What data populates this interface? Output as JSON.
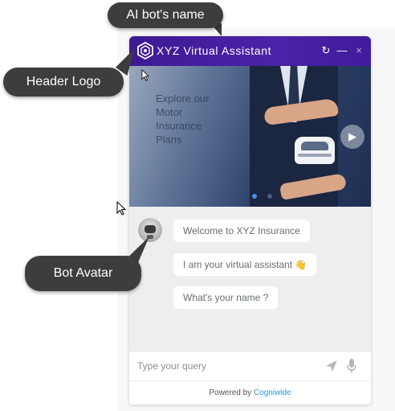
{
  "header": {
    "title": "XYZ Virtual Assistant",
    "logo_icon": "hexagon-logo-icon",
    "refresh_icon": "↻",
    "minimize_icon": "—",
    "close_icon": "×",
    "color": "#4a23a8"
  },
  "banner": {
    "text_lines": [
      "Explore our",
      "Motor",
      "Insurance",
      "Plans"
    ],
    "next_icon": "▶",
    "slide_count": 2,
    "active_slide": 1
  },
  "messages": [
    {
      "text": "Welcome to XYZ Insurance"
    },
    {
      "text": "I am your virtual assistant 👋"
    },
    {
      "text": "What's your name ?"
    }
  ],
  "input": {
    "placeholder": "Type your query",
    "send_icon": "send-icon",
    "mic_icon": "mic-icon"
  },
  "footer": {
    "prefix": "Powered by ",
    "brand": "Cogniwide",
    "brand_color": "#2f8fd8"
  },
  "callouts": {
    "name": "AI bot's name",
    "logo": "Header Logo",
    "avatar": "Bot Avatar"
  }
}
